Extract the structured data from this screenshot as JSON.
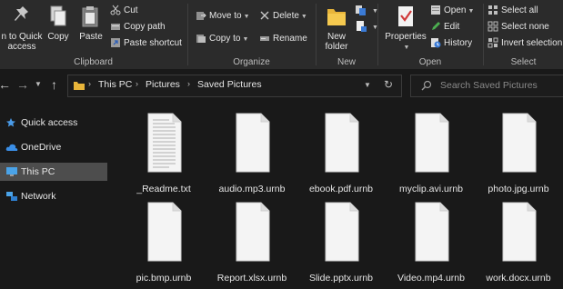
{
  "ribbon": {
    "clipboard": {
      "pin_label_line1": "n to Quick",
      "pin_label_line2": "access",
      "copy_label": "Copy",
      "paste_label": "Paste",
      "cut_label": "Cut",
      "copy_path_label": "Copy path",
      "paste_shortcut_label": "Paste shortcut",
      "group_label": "Clipboard"
    },
    "organize": {
      "move_to_label": "Move to",
      "copy_to_label": "Copy to",
      "delete_label": "Delete",
      "rename_label": "Rename",
      "group_label": "Organize"
    },
    "new": {
      "new_folder_line1": "New",
      "new_folder_line2": "folder",
      "group_label": "New"
    },
    "open": {
      "properties_label": "Properties",
      "open_label": "Open",
      "edit_label": "Edit",
      "history_label": "History",
      "group_label": "Open"
    },
    "select": {
      "select_all_label": "Select all",
      "select_none_label": "Select none",
      "invert_selection_label": "Invert selection",
      "group_label": "Select"
    }
  },
  "address": {
    "crumbs": [
      "This PC",
      "Pictures",
      "Saved Pictures"
    ]
  },
  "search": {
    "placeholder": "Search Saved Pictures"
  },
  "nav": {
    "items": [
      {
        "label": "Quick access",
        "icon": "star-icon"
      },
      {
        "label": "OneDrive",
        "icon": "cloud-icon"
      },
      {
        "label": "This PC",
        "icon": "monitor-icon",
        "selected": true
      },
      {
        "label": "Network",
        "icon": "network-icon"
      }
    ]
  },
  "files": [
    {
      "name": "_Readme.txt",
      "icon": "text-file-icon"
    },
    {
      "name": "audio.mp3.urnb",
      "icon": "file-icon"
    },
    {
      "name": "ebook.pdf.urnb",
      "icon": "file-icon"
    },
    {
      "name": "myclip.avi.urnb",
      "icon": "file-icon"
    },
    {
      "name": "photo.jpg.urnb",
      "icon": "file-icon"
    },
    {
      "name": "pic.bmp.urnb",
      "icon": "file-icon"
    },
    {
      "name": "Report.xlsx.urnb",
      "icon": "file-icon"
    },
    {
      "name": "Slide.pptx.urnb",
      "icon": "file-icon"
    },
    {
      "name": "Video.mp4.urnb",
      "icon": "file-icon"
    },
    {
      "name": "work.docx.urnb",
      "icon": "file-icon"
    }
  ],
  "colors": {
    "ribbon_bg": "#2b2b2b",
    "window_bg": "#191919",
    "selected_nav": "#4d4d4d",
    "folder_yellow": "#e8b53a"
  }
}
